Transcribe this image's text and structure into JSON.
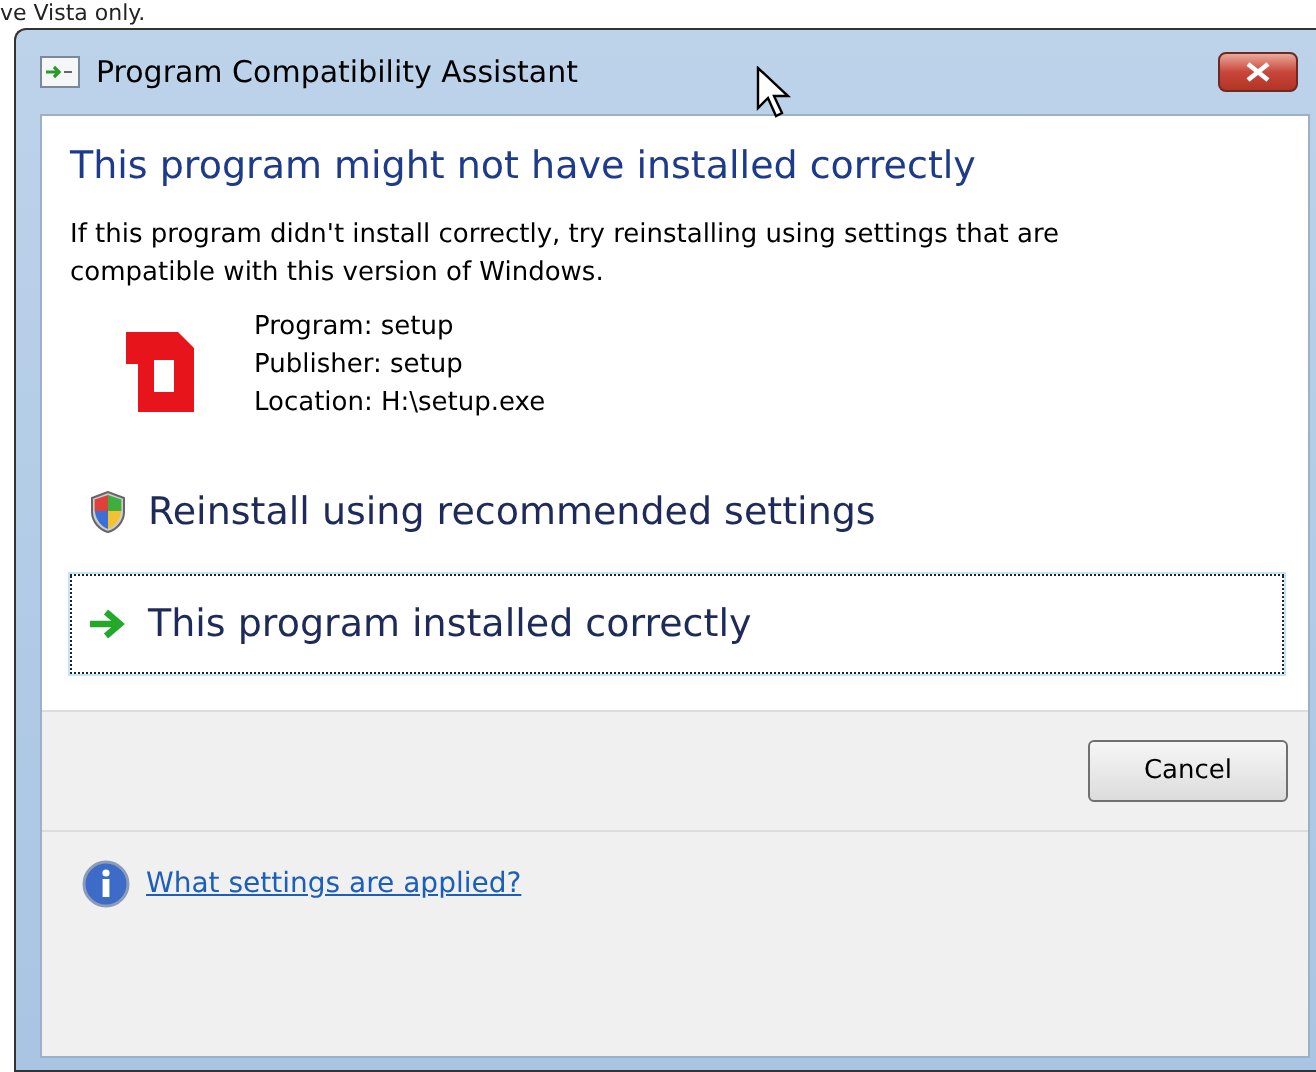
{
  "page_text": "ve Vista only.",
  "window": {
    "title": "Program Compatibility Assistant"
  },
  "heading": "This program might not have installed correctly",
  "message": "If this program didn't install correctly, try reinstalling using settings that are compatible with this version of Windows.",
  "details": [
    "Program: setup",
    "Publisher: setup",
    "Location: H:\\setup.exe"
  ],
  "options": [
    {
      "kind": "shield",
      "label": "Reinstall using recommended settings",
      "selected": false
    },
    {
      "kind": "arrow",
      "label": "This program installed correctly",
      "selected": true
    }
  ],
  "buttons": [
    "Cancel"
  ],
  "help_link": "What settings are applied?"
}
